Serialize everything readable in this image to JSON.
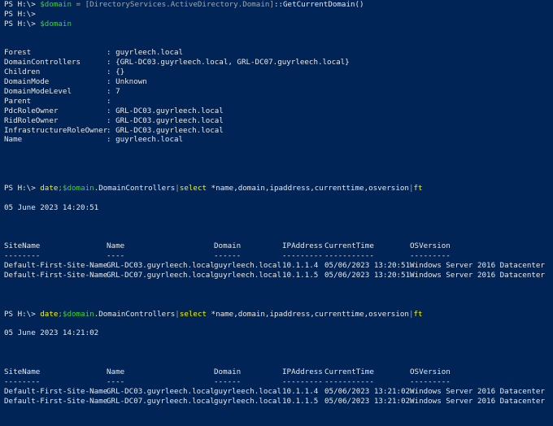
{
  "prompt": "PS H:\\> ",
  "cmd1": {
    "var": "$domain",
    "eq": " = ",
    "type": "[DirectoryServices.ActiveDirectory.Domain]",
    "method": "::GetCurrentDomain()"
  },
  "cmd2": {
    "var": "$domain"
  },
  "domain_props": [
    {
      "key": "Forest",
      "value": "guyrleech.local"
    },
    {
      "key": "DomainControllers",
      "value": "{GRL-DC03.guyrleech.local, GRL-DC07.guyrleech.local}"
    },
    {
      "key": "Children",
      "value": "{}"
    },
    {
      "key": "DomainMode",
      "value": "Unknown"
    },
    {
      "key": "DomainModeLevel",
      "value": "7"
    },
    {
      "key": "Parent",
      "value": ""
    },
    {
      "key": "PdcRoleOwner",
      "value": "GRL-DC03.guyrleech.local"
    },
    {
      "key": "RidRoleOwner",
      "value": "GRL-DC03.guyrleech.local"
    },
    {
      "key": "InfrastructureRoleOwner",
      "value": "GRL-DC03.guyrleech.local"
    },
    {
      "key": "Name",
      "value": "guyrleech.local"
    }
  ],
  "cmd3": {
    "date": "date",
    "sep": ";",
    "var": "$domain",
    "prop": ".DomainControllers",
    "pipe1": "|",
    "select": "select",
    "args": " *name,domain,ipaddress,currenttime,osversion",
    "pipe2": "|",
    "ft": "ft"
  },
  "runs": [
    {
      "date_output": "05 June 2023 14:20:51",
      "rows": [
        [
          "Default-First-Site-Name",
          "GRL-DC03.guyrleech.local",
          "guyrleech.local",
          "10.1.1.4",
          "05/06/2023 13:20:51",
          "Windows Server 2016 Datacenter"
        ],
        [
          "Default-First-Site-Name",
          "GRL-DC07.guyrleech.local",
          "guyrleech.local",
          "10.1.1.5",
          "05/06/2023 13:20:51",
          "Windows Server 2016 Datacenter"
        ]
      ]
    },
    {
      "date_output": "05 June 2023 14:21:02",
      "rows": [
        [
          "Default-First-Site-Name",
          "GRL-DC03.guyrleech.local",
          "guyrleech.local",
          "10.1.1.4",
          "05/06/2023 13:21:02",
          "Windows Server 2016 Datacenter"
        ],
        [
          "Default-First-Site-Name",
          "GRL-DC07.guyrleech.local",
          "guyrleech.local",
          "10.1.1.5",
          "05/06/2023 13:21:02",
          "Windows Server 2016 Datacenter"
        ]
      ]
    }
  ],
  "table_headers": [
    "SiteName",
    "Name",
    "Domain",
    "IPAddress",
    "CurrentTime",
    "OSVersion"
  ],
  "table_underlines": [
    "--------",
    "----",
    "------",
    "---------",
    "-----------",
    "---------"
  ],
  "colors": {
    "background": "#012456",
    "text": "#e8e8e8",
    "variable": "#3ad23a",
    "command": "#f5f500",
    "type": "#a7a7a7"
  }
}
